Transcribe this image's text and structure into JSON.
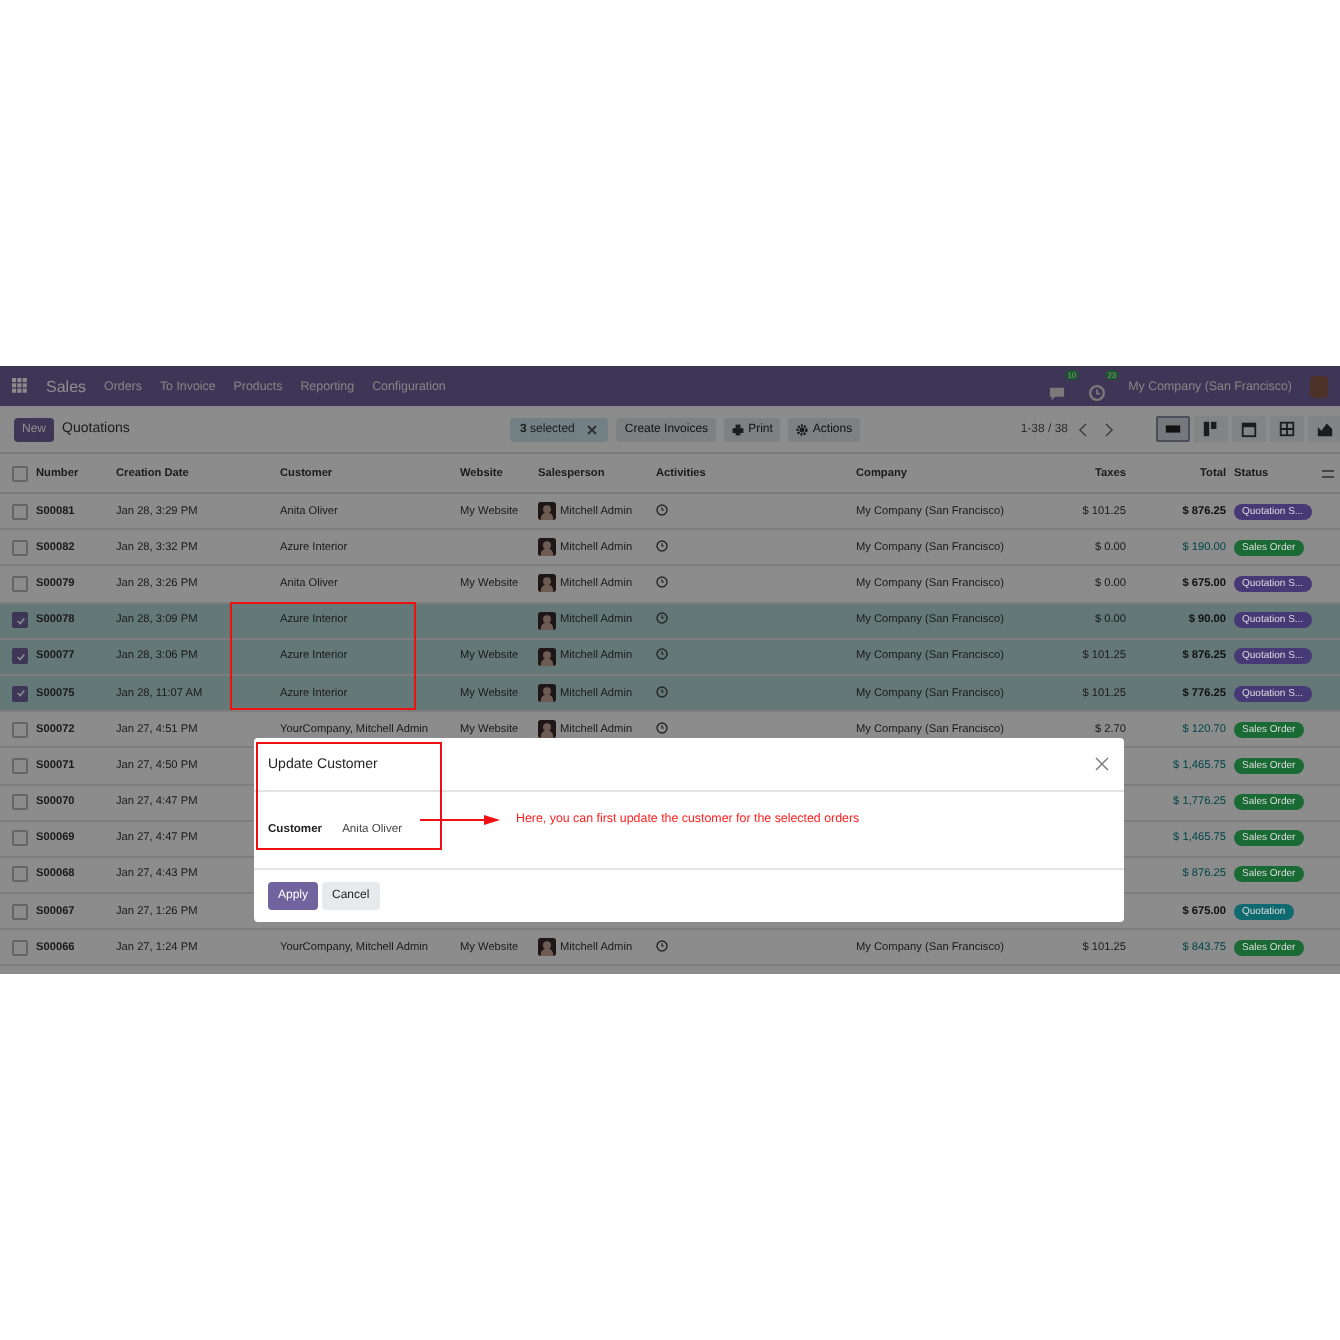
{
  "navbar": {
    "app": "Sales",
    "menu": [
      "Orders",
      "To Invoice",
      "Products",
      "Reporting",
      "Configuration"
    ],
    "messages_badge": "10",
    "activities_badge": "23",
    "company": "My Company (San Francisco)"
  },
  "control_panel": {
    "new_button": "New",
    "breadcrumb": "Quotations",
    "selection": "**3** selected",
    "actions": [
      {
        "label": "Create Invoices"
      },
      {
        "label": "Print"
      },
      {
        "label": "Actions"
      }
    ],
    "pager": "1-38 / 38",
    "views": [
      {
        "kind": "list",
        "selected": true
      },
      {
        "kind": "kanban",
        "selected": false
      },
      {
        "kind": "calendar",
        "selected": false
      },
      {
        "kind": "pivot",
        "selected": false
      },
      {
        "kind": "graph",
        "selected": false
      }
    ]
  },
  "table": {
    "all_selected": false,
    "columns": [
      "Number",
      "Creation Date",
      "Customer",
      "Website",
      "Salesperson",
      "Activities",
      "Company",
      "Taxes",
      "Total",
      "Status"
    ],
    "rows": [
      {
        "selected": false,
        "number": "S00081",
        "date": "Jan 28, 3:29 PM",
        "customer": "Anita Oliver",
        "website": "My Website",
        "salesperson": "Mitchell Admin",
        "activity": true,
        "company": "My Company (San Francisco)",
        "taxes": "$ 101.25",
        "total": "$ 876.25",
        "status": {
          "kind": "quotation_sent",
          "label": "Quotation S...",
          "color": "#453a76"
        }
      },
      {
        "selected": false,
        "number": "S00082",
        "date": "Jan 28, 3:32 PM",
        "customer": "Azure Interior",
        "salesperson": "Mitchell Admin",
        "activity": true,
        "company": "My Company (San Francisco)",
        "taxes": "$ 0.00",
        "total": "$ 190.00",
        "status": {
          "kind": "sales_order",
          "label": "Sales Order",
          "color": "#1a6a35"
        }
      },
      {
        "selected": false,
        "number": "S00079",
        "date": "Jan 28, 3:26 PM",
        "customer": "Anita Oliver",
        "website": "My Website",
        "salesperson": "Mitchell Admin",
        "activity": true,
        "company": "My Company (San Francisco)",
        "taxes": "$ 0.00",
        "total": "$ 675.00",
        "status": {
          "kind": "quotation_sent",
          "label": "Quotation S...",
          "color": "#453a76"
        }
      },
      {
        "selected": true,
        "number": "S00078",
        "date": "Jan 28, 3:09 PM",
        "customer": "Azure Interior",
        "salesperson": "Mitchell Admin",
        "activity": true,
        "company": "My Company (San Francisco)",
        "taxes": "$ 0.00",
        "total": "$ 90.00",
        "status": {
          "kind": "quotation_sent",
          "label": "Quotation S...",
          "color": "#453a76"
        }
      },
      {
        "selected": true,
        "number": "S00077",
        "date": "Jan 28, 3:06 PM",
        "customer": "Azure Interior",
        "website": "My Website",
        "salesperson": "Mitchell Admin",
        "activity": true,
        "company": "My Company (San Francisco)",
        "taxes": "$ 101.25",
        "total": "$ 876.25",
        "status": {
          "kind": "quotation_sent",
          "label": "Quotation S...",
          "color": "#453a76"
        }
      },
      {
        "selected": true,
        "number": "S00075",
        "date": "Jan 28, 11:07 AM",
        "customer": "Azure Interior",
        "website": "My Website",
        "salesperson": "Mitchell Admin",
        "activity": true,
        "company": "My Company (San Francisco)",
        "taxes": "$ 101.25",
        "total": "$ 776.25",
        "status": {
          "kind": "quotation_sent",
          "label": "Quotation S...",
          "color": "#453a76"
        }
      },
      {
        "selected": false,
        "number": "S00072",
        "date": "Jan 27, 4:51 PM",
        "customer": "YourCompany, Mitchell Admin",
        "website": "My Website",
        "salesperson": "Mitchell Admin",
        "activity": true,
        "company": "My Company (San Francisco)",
        "taxes": "$ 2.70",
        "total": "$ 120.70",
        "status": {
          "kind": "sales_order",
          "label": "Sales Order",
          "color": "#1a6a35"
        }
      },
      {
        "selected": false,
        "number": "S00071",
        "date": "Jan 27, 4:50 PM",
        "total": "$ 1,465.75",
        "status": {
          "kind": "sales_order",
          "label": "Sales Order",
          "color": "#1a6a35"
        }
      },
      {
        "selected": false,
        "number": "S00070",
        "date": "Jan 27, 4:47 PM",
        "total": "$ 1,776.25",
        "status": {
          "kind": "sales_order",
          "label": "Sales Order",
          "color": "#1a6a35"
        }
      },
      {
        "selected": false,
        "number": "S00069",
        "date": "Jan 27, 4:47 PM",
        "total": "$ 1,465.75",
        "status": {
          "kind": "sales_order",
          "label": "Sales Order",
          "color": "#1a6a35"
        }
      },
      {
        "selected": false,
        "number": "S00068",
        "date": "Jan 27, 4:43 PM",
        "total": "$ 876.25",
        "status": {
          "kind": "sales_order",
          "label": "Sales Order",
          "color": "#1a6a35"
        }
      },
      {
        "selected": false,
        "number": "S00067",
        "date": "Jan 27, 1:26 PM",
        "total": "$ 675.00",
        "status": {
          "kind": "quotation",
          "label": "Quotation",
          "color": "#0f6a70"
        }
      },
      {
        "selected": false,
        "number": "S00066",
        "date": "Jan 27, 1:24 PM",
        "customer": "YourCompany, Mitchell Admin",
        "website": "My Website",
        "salesperson": "Mitchell Admin",
        "activity": true,
        "company": "My Company (San Francisco)",
        "taxes": "$ 101.25",
        "total": "$ 843.75",
        "status": {
          "kind": "sales_order",
          "label": "Sales Order",
          "color": "#1a6a35"
        }
      }
    ]
  },
  "dialog": {
    "title": "Update Customer",
    "field_label": "Customer",
    "field_value": "Anita Oliver",
    "buttons": [
      {
        "label": "Apply",
        "kind": "primary"
      },
      {
        "label": "Cancel",
        "kind": "secondary"
      }
    ]
  },
  "annotation": {
    "note": "Here, you can first update the customer for the selected orders"
  }
}
